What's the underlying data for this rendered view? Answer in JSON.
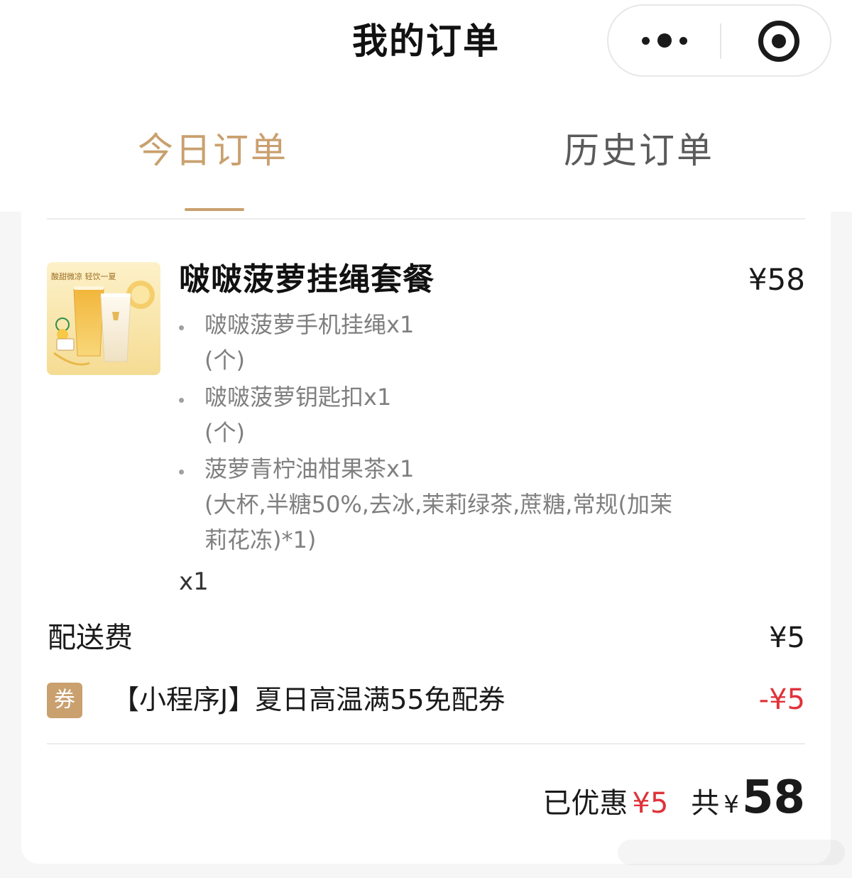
{
  "header": {
    "title": "我的订单",
    "more_icon": "more-dots-icon",
    "close_icon": "target-close-icon"
  },
  "tabs": [
    {
      "label": "今日订单",
      "active": true
    },
    {
      "label": "历史订单",
      "active": false
    }
  ],
  "order": {
    "item": {
      "name": "啵啵菠萝挂绳套餐",
      "price": "¥58",
      "image_icon": "product-photo",
      "image_text": "酸甜微凉 轻饮一夏",
      "components": [
        {
          "name": "啵啵菠萝手机挂绳x1",
          "spec": "(个)"
        },
        {
          "name": "啵啵菠萝钥匙扣x1",
          "spec": "(个)"
        },
        {
          "name": "菠萝青柠油柑果茶x1",
          "spec_line1": "(大杯,半糖50%,去冰,茉莉绿茶,蔗糖,常规(加茉",
          "spec_line2": "莉花冻)*1)"
        }
      ],
      "quantity": "x1"
    },
    "delivery_fee": {
      "label": "配送费",
      "value": "¥5"
    },
    "coupon": {
      "badge": "券",
      "name": "【小程序J】夏日高温满55免配券",
      "value": "-¥5"
    },
    "summary": {
      "discount_label": "已优惠",
      "discount_value": "¥5",
      "total_label": "共",
      "currency": "¥",
      "total_value": "58"
    }
  },
  "colors": {
    "accent": "#c9a06e",
    "discount_red": "#e0323a",
    "muted_text": "#7f7f7f"
  }
}
